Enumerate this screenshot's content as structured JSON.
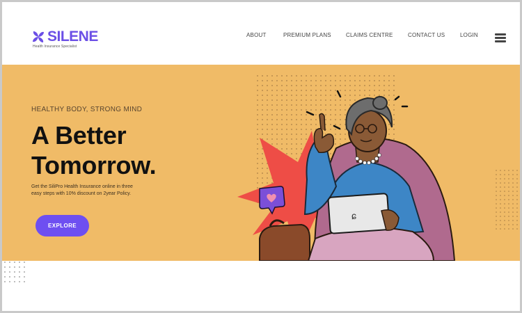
{
  "brand": {
    "name": "SILENE",
    "tagline": "Health Insurance Specialist",
    "color": "#6b4fe6"
  },
  "nav": {
    "items": [
      {
        "label": "ABOUT"
      },
      {
        "label": "PREMIUM PLANS"
      },
      {
        "label": "CLAIMS CENTRE"
      },
      {
        "label": "CONTACT US"
      },
      {
        "label": "LOGIN"
      }
    ],
    "menu_icon": "hamburger-menu-icon"
  },
  "hero": {
    "eyebrow": "HEALTHY BODY, STRONG MIND",
    "headline": "A Better\nTomorrow.",
    "description": "Get the SiliPro  Health Insurance online in three easy steps with 10% discount on 2year Policy.",
    "cta_label": "EXPLORE",
    "background": "#f0bb67",
    "cta_color": "#6e4ff1"
  }
}
